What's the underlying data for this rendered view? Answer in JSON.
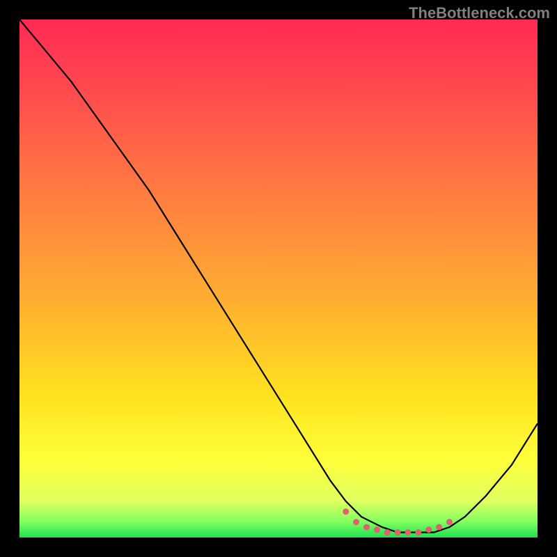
{
  "watermark": "TheBottleneck.com",
  "chart_data": {
    "type": "line",
    "title": "",
    "xlabel": "",
    "ylabel": "",
    "xlim": [
      0,
      100
    ],
    "ylim": [
      0,
      100
    ],
    "series": [
      {
        "name": "bottleneck-curve",
        "x": [
          0,
          5,
          10,
          15,
          20,
          25,
          30,
          35,
          40,
          45,
          50,
          55,
          60,
          63,
          66,
          70,
          73,
          76,
          80,
          83,
          86,
          90,
          95,
          100
        ],
        "y": [
          100,
          94,
          88,
          81,
          74,
          67,
          59,
          51,
          43,
          35,
          27,
          19,
          11,
          7,
          4,
          2,
          1,
          1,
          1,
          2,
          4,
          8,
          14,
          22
        ]
      },
      {
        "name": "sweet-spot-markers",
        "x": [
          63,
          65,
          67,
          69,
          71,
          73,
          75,
          77,
          79,
          81,
          83
        ],
        "y": [
          5,
          3,
          2,
          1.5,
          1,
          1,
          1,
          1,
          1.5,
          2,
          3
        ]
      }
    ],
    "background_gradient": {
      "stops": [
        {
          "offset": 0.0,
          "color": "#ff2a55"
        },
        {
          "offset": 0.15,
          "color": "#ff4d4d"
        },
        {
          "offset": 0.35,
          "color": "#ff8040"
        },
        {
          "offset": 0.55,
          "color": "#ffb030"
        },
        {
          "offset": 0.72,
          "color": "#ffe020"
        },
        {
          "offset": 0.85,
          "color": "#ffff3a"
        },
        {
          "offset": 0.93,
          "color": "#e0ff60"
        },
        {
          "offset": 0.97,
          "color": "#80ff60"
        },
        {
          "offset": 1.0,
          "color": "#20e050"
        }
      ]
    },
    "marker_color": "#e06070"
  }
}
